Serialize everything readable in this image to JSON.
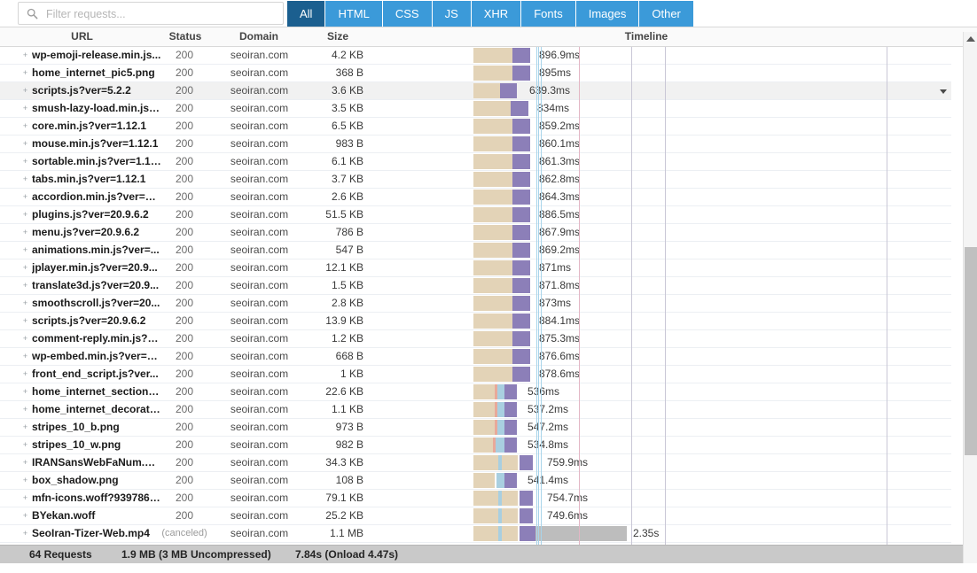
{
  "toolbar": {
    "search": {
      "placeholder": "Filter requests...",
      "value": "",
      "icon": "search-icon"
    },
    "type_filters": [
      {
        "label": "All",
        "selected": true
      },
      {
        "label": "HTML",
        "selected": false
      },
      {
        "label": "CSS",
        "selected": false
      },
      {
        "label": "JS",
        "selected": false
      },
      {
        "label": "XHR",
        "selected": false
      },
      {
        "label": "Fonts",
        "selected": false
      },
      {
        "label": "Images",
        "selected": false
      },
      {
        "label": "Other",
        "selected": false
      }
    ],
    "colors": {
      "tab": "#3b9ad9",
      "tab_selected": "#1b5f8f"
    }
  },
  "columns": {
    "url": "URL",
    "status": "Status",
    "domain": "Domain",
    "size": "Size",
    "timeline": "Timeline"
  },
  "requests": [
    {
      "url": "wp-emoji-release.min.js...",
      "status": "200",
      "domain": "seoiran.com",
      "size": "4.2 KB",
      "time": "896.9ms",
      "wait": 44,
      "recv": 20,
      "recv_at": 44,
      "label_at": 74,
      "selected": false
    },
    {
      "url": "home_internet_pic5.png",
      "status": "200",
      "domain": "seoiran.com",
      "size": "368 B",
      "time": "895ms",
      "wait": 44,
      "recv": 20,
      "recv_at": 44,
      "label_at": 74,
      "selected": false
    },
    {
      "url": "scripts.js?ver=5.2.2",
      "status": "200",
      "domain": "seoiran.com",
      "size": "3.6 KB",
      "time": "639.3ms",
      "wait": 30,
      "recv": 19,
      "recv_at": 30,
      "label_at": 63,
      "selected": true
    },
    {
      "url": "smush-lazy-load.min.js?...",
      "status": "200",
      "domain": "seoiran.com",
      "size": "3.5 KB",
      "time": "834ms",
      "wait": 42,
      "recv": 20,
      "recv_at": 42,
      "label_at": 72,
      "selected": false
    },
    {
      "url": "core.min.js?ver=1.12.1",
      "status": "200",
      "domain": "seoiran.com",
      "size": "6.5 KB",
      "time": "859.2ms",
      "wait": 44,
      "recv": 20,
      "recv_at": 44,
      "label_at": 74,
      "selected": false
    },
    {
      "url": "mouse.min.js?ver=1.12.1",
      "status": "200",
      "domain": "seoiran.com",
      "size": "983 B",
      "time": "860.1ms",
      "wait": 44,
      "recv": 20,
      "recv_at": 44,
      "label_at": 74,
      "selected": false
    },
    {
      "url": "sortable.min.js?ver=1.12.1",
      "status": "200",
      "domain": "seoiran.com",
      "size": "6.1 KB",
      "time": "861.3ms",
      "wait": 44,
      "recv": 20,
      "recv_at": 44,
      "label_at": 74,
      "selected": false
    },
    {
      "url": "tabs.min.js?ver=1.12.1",
      "status": "200",
      "domain": "seoiran.com",
      "size": "3.7 KB",
      "time": "862.8ms",
      "wait": 44,
      "recv": 20,
      "recv_at": 44,
      "label_at": 74,
      "selected": false
    },
    {
      "url": "accordion.min.js?ver=1....",
      "status": "200",
      "domain": "seoiran.com",
      "size": "2.6 KB",
      "time": "864.3ms",
      "wait": 44,
      "recv": 20,
      "recv_at": 44,
      "label_at": 74,
      "selected": false
    },
    {
      "url": "plugins.js?ver=20.9.6.2",
      "status": "200",
      "domain": "seoiran.com",
      "size": "51.5 KB",
      "time": "886.5ms",
      "wait": 44,
      "recv": 20,
      "recv_at": 44,
      "label_at": 74,
      "selected": false
    },
    {
      "url": "menu.js?ver=20.9.6.2",
      "status": "200",
      "domain": "seoiran.com",
      "size": "786 B",
      "time": "867.9ms",
      "wait": 44,
      "recv": 20,
      "recv_at": 44,
      "label_at": 74,
      "selected": false
    },
    {
      "url": "animations.min.js?ver=...",
      "status": "200",
      "domain": "seoiran.com",
      "size": "547 B",
      "time": "869.2ms",
      "wait": 44,
      "recv": 20,
      "recv_at": 44,
      "label_at": 74,
      "selected": false
    },
    {
      "url": "jplayer.min.js?ver=20.9...",
      "status": "200",
      "domain": "seoiran.com",
      "size": "12.1 KB",
      "time": "871ms",
      "wait": 44,
      "recv": 20,
      "recv_at": 44,
      "label_at": 74,
      "selected": false
    },
    {
      "url": "translate3d.js?ver=20.9...",
      "status": "200",
      "domain": "seoiran.com",
      "size": "1.5 KB",
      "time": "871.8ms",
      "wait": 44,
      "recv": 20,
      "recv_at": 44,
      "label_at": 74,
      "selected": false
    },
    {
      "url": "smoothscroll.js?ver=20...",
      "status": "200",
      "domain": "seoiran.com",
      "size": "2.8 KB",
      "time": "873ms",
      "wait": 44,
      "recv": 20,
      "recv_at": 44,
      "label_at": 74,
      "selected": false
    },
    {
      "url": "scripts.js?ver=20.9.6.2",
      "status": "200",
      "domain": "seoiran.com",
      "size": "13.9 KB",
      "time": "884.1ms",
      "wait": 44,
      "recv": 20,
      "recv_at": 44,
      "label_at": 74,
      "selected": false
    },
    {
      "url": "comment-reply.min.js?v...",
      "status": "200",
      "domain": "seoiran.com",
      "size": "1.2 KB",
      "time": "875.3ms",
      "wait": 44,
      "recv": 20,
      "recv_at": 44,
      "label_at": 74,
      "selected": false
    },
    {
      "url": "wp-embed.min.js?ver=5.6",
      "status": "200",
      "domain": "seoiran.com",
      "size": "668 B",
      "time": "876.6ms",
      "wait": 44,
      "recv": 20,
      "recv_at": 44,
      "label_at": 74,
      "selected": false
    },
    {
      "url": "front_end_script.js?ver...",
      "status": "200",
      "domain": "seoiran.com",
      "size": "1 KB",
      "time": "878.6ms",
      "wait": 44,
      "recv": 20,
      "recv_at": 44,
      "label_at": 74,
      "selected": false
    },
    {
      "url": "home_internet_sectionb...",
      "status": "200",
      "domain": "seoiran.com",
      "size": "22.6 KB",
      "time": "536ms",
      "wait": 24,
      "recv": 14,
      "recv_at": 35,
      "label_at": 61,
      "dns_at": 24,
      "dns": 3,
      "conn_at": 27,
      "conn": 8,
      "selected": false
    },
    {
      "url": "home_internet_decorati...",
      "status": "200",
      "domain": "seoiran.com",
      "size": "1.1 KB",
      "time": "537.2ms",
      "wait": 24,
      "recv": 14,
      "recv_at": 35,
      "label_at": 61,
      "dns_at": 24,
      "dns": 3,
      "conn_at": 27,
      "conn": 8,
      "selected": false
    },
    {
      "url": "stripes_10_b.png",
      "status": "200",
      "domain": "seoiran.com",
      "size": "973 B",
      "time": "547.2ms",
      "wait": 24,
      "recv": 14,
      "recv_at": 35,
      "label_at": 61,
      "dns_at": 24,
      "dns": 3,
      "conn_at": 27,
      "conn": 8,
      "selected": false
    },
    {
      "url": "stripes_10_w.png",
      "status": "200",
      "domain": "seoiran.com",
      "size": "982 B",
      "time": "534.8ms",
      "wait": 22,
      "recv": 14,
      "recv_at": 35,
      "label_at": 61,
      "dns_at": 22,
      "dns": 3,
      "conn_at": 25,
      "conn": 10,
      "selected": false
    },
    {
      "url": "IRANSansWebFaNum.w...",
      "status": "200",
      "domain": "seoiran.com",
      "size": "34.3 KB",
      "time": "759.9ms",
      "wait": 50,
      "recv": 15,
      "recv_at": 52,
      "label_at": 83,
      "conn_at": 28,
      "conn": 4,
      "selected": false
    },
    {
      "url": "box_shadow.png",
      "status": "200",
      "domain": "seoiran.com",
      "size": "108 B",
      "time": "541.4ms",
      "wait": 24,
      "recv": 14,
      "recv_at": 35,
      "label_at": 61,
      "conn_at": 26,
      "conn": 9,
      "selected": false
    },
    {
      "url": "mfn-icons.woff?93978679",
      "status": "200",
      "domain": "seoiran.com",
      "size": "79.1 KB",
      "time": "754.7ms",
      "wait": 50,
      "recv": 15,
      "recv_at": 52,
      "label_at": 83,
      "conn_at": 28,
      "conn": 4,
      "selected": false
    },
    {
      "url": "BYekan.woff",
      "status": "200",
      "domain": "seoiran.com",
      "size": "25.2 KB",
      "time": "749.6ms",
      "wait": 50,
      "recv": 15,
      "recv_at": 52,
      "label_at": 83,
      "conn_at": 28,
      "conn": 4,
      "selected": false
    },
    {
      "url": "SeoIran-Tizer-Web.mp4",
      "status": "(canceled)",
      "domain": "seoiran.com",
      "size": "1.1 MB",
      "time": "2.35s",
      "wait": 50,
      "recv": 18,
      "recv_at": 52,
      "label_at": 180,
      "conn_at": 28,
      "conn": 4,
      "stall_at": 70,
      "stall": 103,
      "selected": false
    }
  ],
  "timeline_guides": {
    "blue_lines": [
      193,
      195,
      198
    ],
    "pink_line": 241,
    "gray_lines": [
      300,
      338,
      588
    ]
  },
  "segment_colors": {
    "waiting": "#e3d3b7",
    "dns": "#e8a99a",
    "connecting": "#a9cfe0",
    "receiving": "#8c7fb8",
    "stalled": "#bdbdbd"
  },
  "scrollbar": {
    "up_icon": "chevron-up-icon",
    "down_icon": "chevron-down-icon"
  },
  "row_menu": {
    "icon": "chevron-down-icon"
  },
  "statusbar": {
    "requests": "64 Requests",
    "size": "1.9 MB  (3 MB Uncompressed)",
    "time": "7.84s  (Onload 4.47s)"
  }
}
